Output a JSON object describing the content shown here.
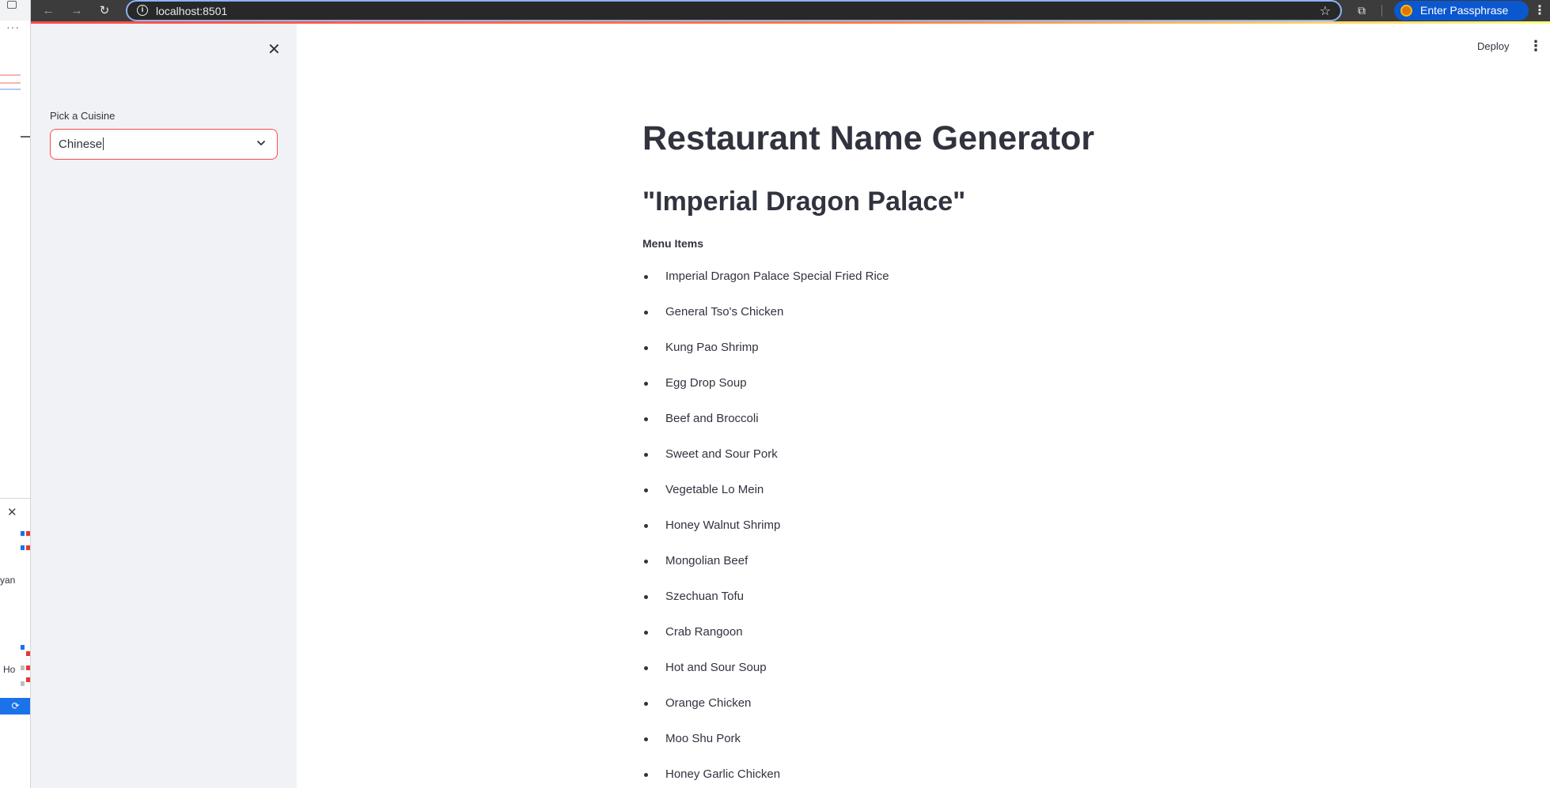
{
  "left_strip": {
    "dots": "···",
    "close": "✕",
    "text1": "yan",
    "text2": "Ho"
  },
  "browser": {
    "url": "localhost:8501",
    "profile_label": "Enter Passphrase",
    "icons": [
      "back-arrow-icon",
      "forward-arrow-icon",
      "reload-icon",
      "info-icon",
      "star-icon",
      "extensions-icon",
      "more-vert-icon"
    ]
  },
  "sidebar": {
    "close": "✕",
    "select_label": "Pick a Cuisine",
    "select_value": "Chinese"
  },
  "header": {
    "deploy_label": "Deploy",
    "menu_glyph": "⋮"
  },
  "main": {
    "title": "Restaurant Name Generator",
    "restaurant_name": "\"Imperial Dragon Palace\"",
    "menu_label": "Menu Items",
    "menu_items": [
      "Imperial Dragon Palace Special Fried Rice",
      "General Tso's Chicken",
      "Kung Pao Shrimp",
      "Egg Drop Soup",
      "Beef and Broccoli",
      "Sweet and Sour Pork",
      "Vegetable Lo Mein",
      "Honey Walnut Shrimp",
      "Mongolian Beef",
      "Szechuan Tofu",
      "Crab Rangoon",
      "Hot and Sour Soup",
      "Orange Chicken",
      "Moo Shu Pork",
      "Honey Garlic Chicken"
    ]
  },
  "colors": {
    "accent": "#ff4b4b",
    "sidebar_bg": "#f0f2f6",
    "profile_pill": "#0b57d0",
    "text": "#31333f"
  }
}
